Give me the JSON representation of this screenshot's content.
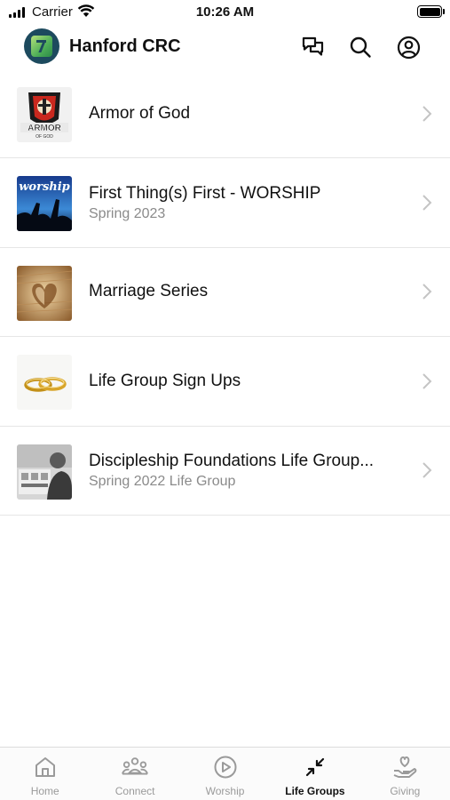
{
  "status_bar": {
    "carrier": "Carrier",
    "time": "10:26 AM"
  },
  "header": {
    "title": "Hanford CRC",
    "icons": [
      "chat-icon",
      "search-icon",
      "account-icon"
    ]
  },
  "groups": [
    {
      "title": "Armor of God",
      "subtitle": "",
      "thumb": "armor-of-god-image"
    },
    {
      "title": "First Thing(s) First - WORSHIP",
      "subtitle": "Spring 2023",
      "thumb": "worship-image",
      "thumb_text": "worship"
    },
    {
      "title": "Marriage Series",
      "subtitle": "",
      "thumb": "heart-book-image"
    },
    {
      "title": "Life Group Sign Ups",
      "subtitle": "",
      "thumb": "wedding-rings-image"
    },
    {
      "title": "Discipleship Foundations Life Group...",
      "subtitle": "Spring 2022 Life Group",
      "thumb": "group-photo-image"
    }
  ],
  "tabs": [
    {
      "label": "Home",
      "icon": "home-icon",
      "active": false
    },
    {
      "label": "Connect",
      "icon": "people-icon",
      "active": false
    },
    {
      "label": "Worship",
      "icon": "play-circle-icon",
      "active": false
    },
    {
      "label": "Life Groups",
      "icon": "arrows-in-icon",
      "active": true
    },
    {
      "label": "Giving",
      "icon": "heart-hand-icon",
      "active": false
    }
  ],
  "colors": {
    "accent": "#111111",
    "inactive_tab": "#9a9a9a",
    "subtitle": "#8a8a8a",
    "logo_bg": "#1d4a5e"
  }
}
